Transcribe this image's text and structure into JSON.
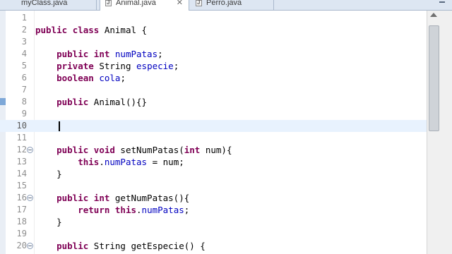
{
  "tabs": [
    {
      "label": "myClass.java",
      "active": false
    },
    {
      "label": "Animal.java",
      "active": true,
      "close_icon": "close-icon"
    },
    {
      "label": "Perro.java",
      "active": false
    }
  ],
  "editor": {
    "current_line": 10,
    "lines": [
      {
        "n": "1",
        "tokens": []
      },
      {
        "n": "2",
        "tokens": [
          [
            "kw",
            "public"
          ],
          [
            "t",
            " "
          ],
          [
            "kw",
            "class"
          ],
          [
            "t",
            " Animal {"
          ]
        ]
      },
      {
        "n": "3",
        "tokens": []
      },
      {
        "n": "4",
        "tokens": [
          [
            "t",
            "    "
          ],
          [
            "kw",
            "public"
          ],
          [
            "t",
            " "
          ],
          [
            "kw",
            "int"
          ],
          [
            "t",
            " "
          ],
          [
            "fld",
            "numPatas"
          ],
          [
            "t",
            ";"
          ]
        ]
      },
      {
        "n": "5",
        "tokens": [
          [
            "t",
            "    "
          ],
          [
            "kw",
            "private"
          ],
          [
            "t",
            " String "
          ],
          [
            "fld",
            "especie"
          ],
          [
            "t",
            ";"
          ]
        ]
      },
      {
        "n": "6",
        "tokens": [
          [
            "t",
            "    "
          ],
          [
            "kw",
            "boolean"
          ],
          [
            "t",
            " "
          ],
          [
            "fld",
            "cola"
          ],
          [
            "t",
            ";"
          ]
        ]
      },
      {
        "n": "7",
        "tokens": []
      },
      {
        "n": "8",
        "tokens": [
          [
            "t",
            "    "
          ],
          [
            "kw",
            "public"
          ],
          [
            "t",
            " Animal(){}"
          ]
        ],
        "marker": true
      },
      {
        "n": "9",
        "tokens": []
      },
      {
        "n": "10",
        "tokens": [
          [
            "t",
            "    "
          ]
        ],
        "caret": true
      },
      {
        "n": "11",
        "tokens": []
      },
      {
        "n": "12",
        "fold": true,
        "tokens": [
          [
            "t",
            "    "
          ],
          [
            "kw",
            "public"
          ],
          [
            "t",
            " "
          ],
          [
            "kw",
            "void"
          ],
          [
            "t",
            " setNumPatas("
          ],
          [
            "kw",
            "int"
          ],
          [
            "t",
            " num){"
          ]
        ]
      },
      {
        "n": "13",
        "tokens": [
          [
            "t",
            "        "
          ],
          [
            "kw",
            "this"
          ],
          [
            "t",
            "."
          ],
          [
            "fld",
            "numPatas"
          ],
          [
            "t",
            " = num;"
          ]
        ]
      },
      {
        "n": "14",
        "tokens": [
          [
            "t",
            "    }"
          ]
        ]
      },
      {
        "n": "15",
        "tokens": []
      },
      {
        "n": "16",
        "fold": true,
        "tokens": [
          [
            "t",
            "    "
          ],
          [
            "kw",
            "public"
          ],
          [
            "t",
            " "
          ],
          [
            "kw",
            "int"
          ],
          [
            "t",
            " getNumPatas(){"
          ]
        ]
      },
      {
        "n": "17",
        "tokens": [
          [
            "t",
            "        "
          ],
          [
            "kw",
            "return"
          ],
          [
            "t",
            " "
          ],
          [
            "kw",
            "this"
          ],
          [
            "t",
            "."
          ],
          [
            "fld",
            "numPatas"
          ],
          [
            "t",
            ";"
          ]
        ]
      },
      {
        "n": "18",
        "tokens": [
          [
            "t",
            "    }"
          ]
        ]
      },
      {
        "n": "19",
        "tokens": []
      },
      {
        "n": "20",
        "fold": true,
        "tokens": [
          [
            "t",
            "    "
          ],
          [
            "kw",
            "public"
          ],
          [
            "t",
            " String getEspecie() {"
          ]
        ]
      }
    ]
  },
  "colors": {
    "keyword": "#7f0055",
    "field": "#0000c0",
    "current_line_bg": "#e8f2fe",
    "tabbar_bg": "#dde6f2"
  }
}
